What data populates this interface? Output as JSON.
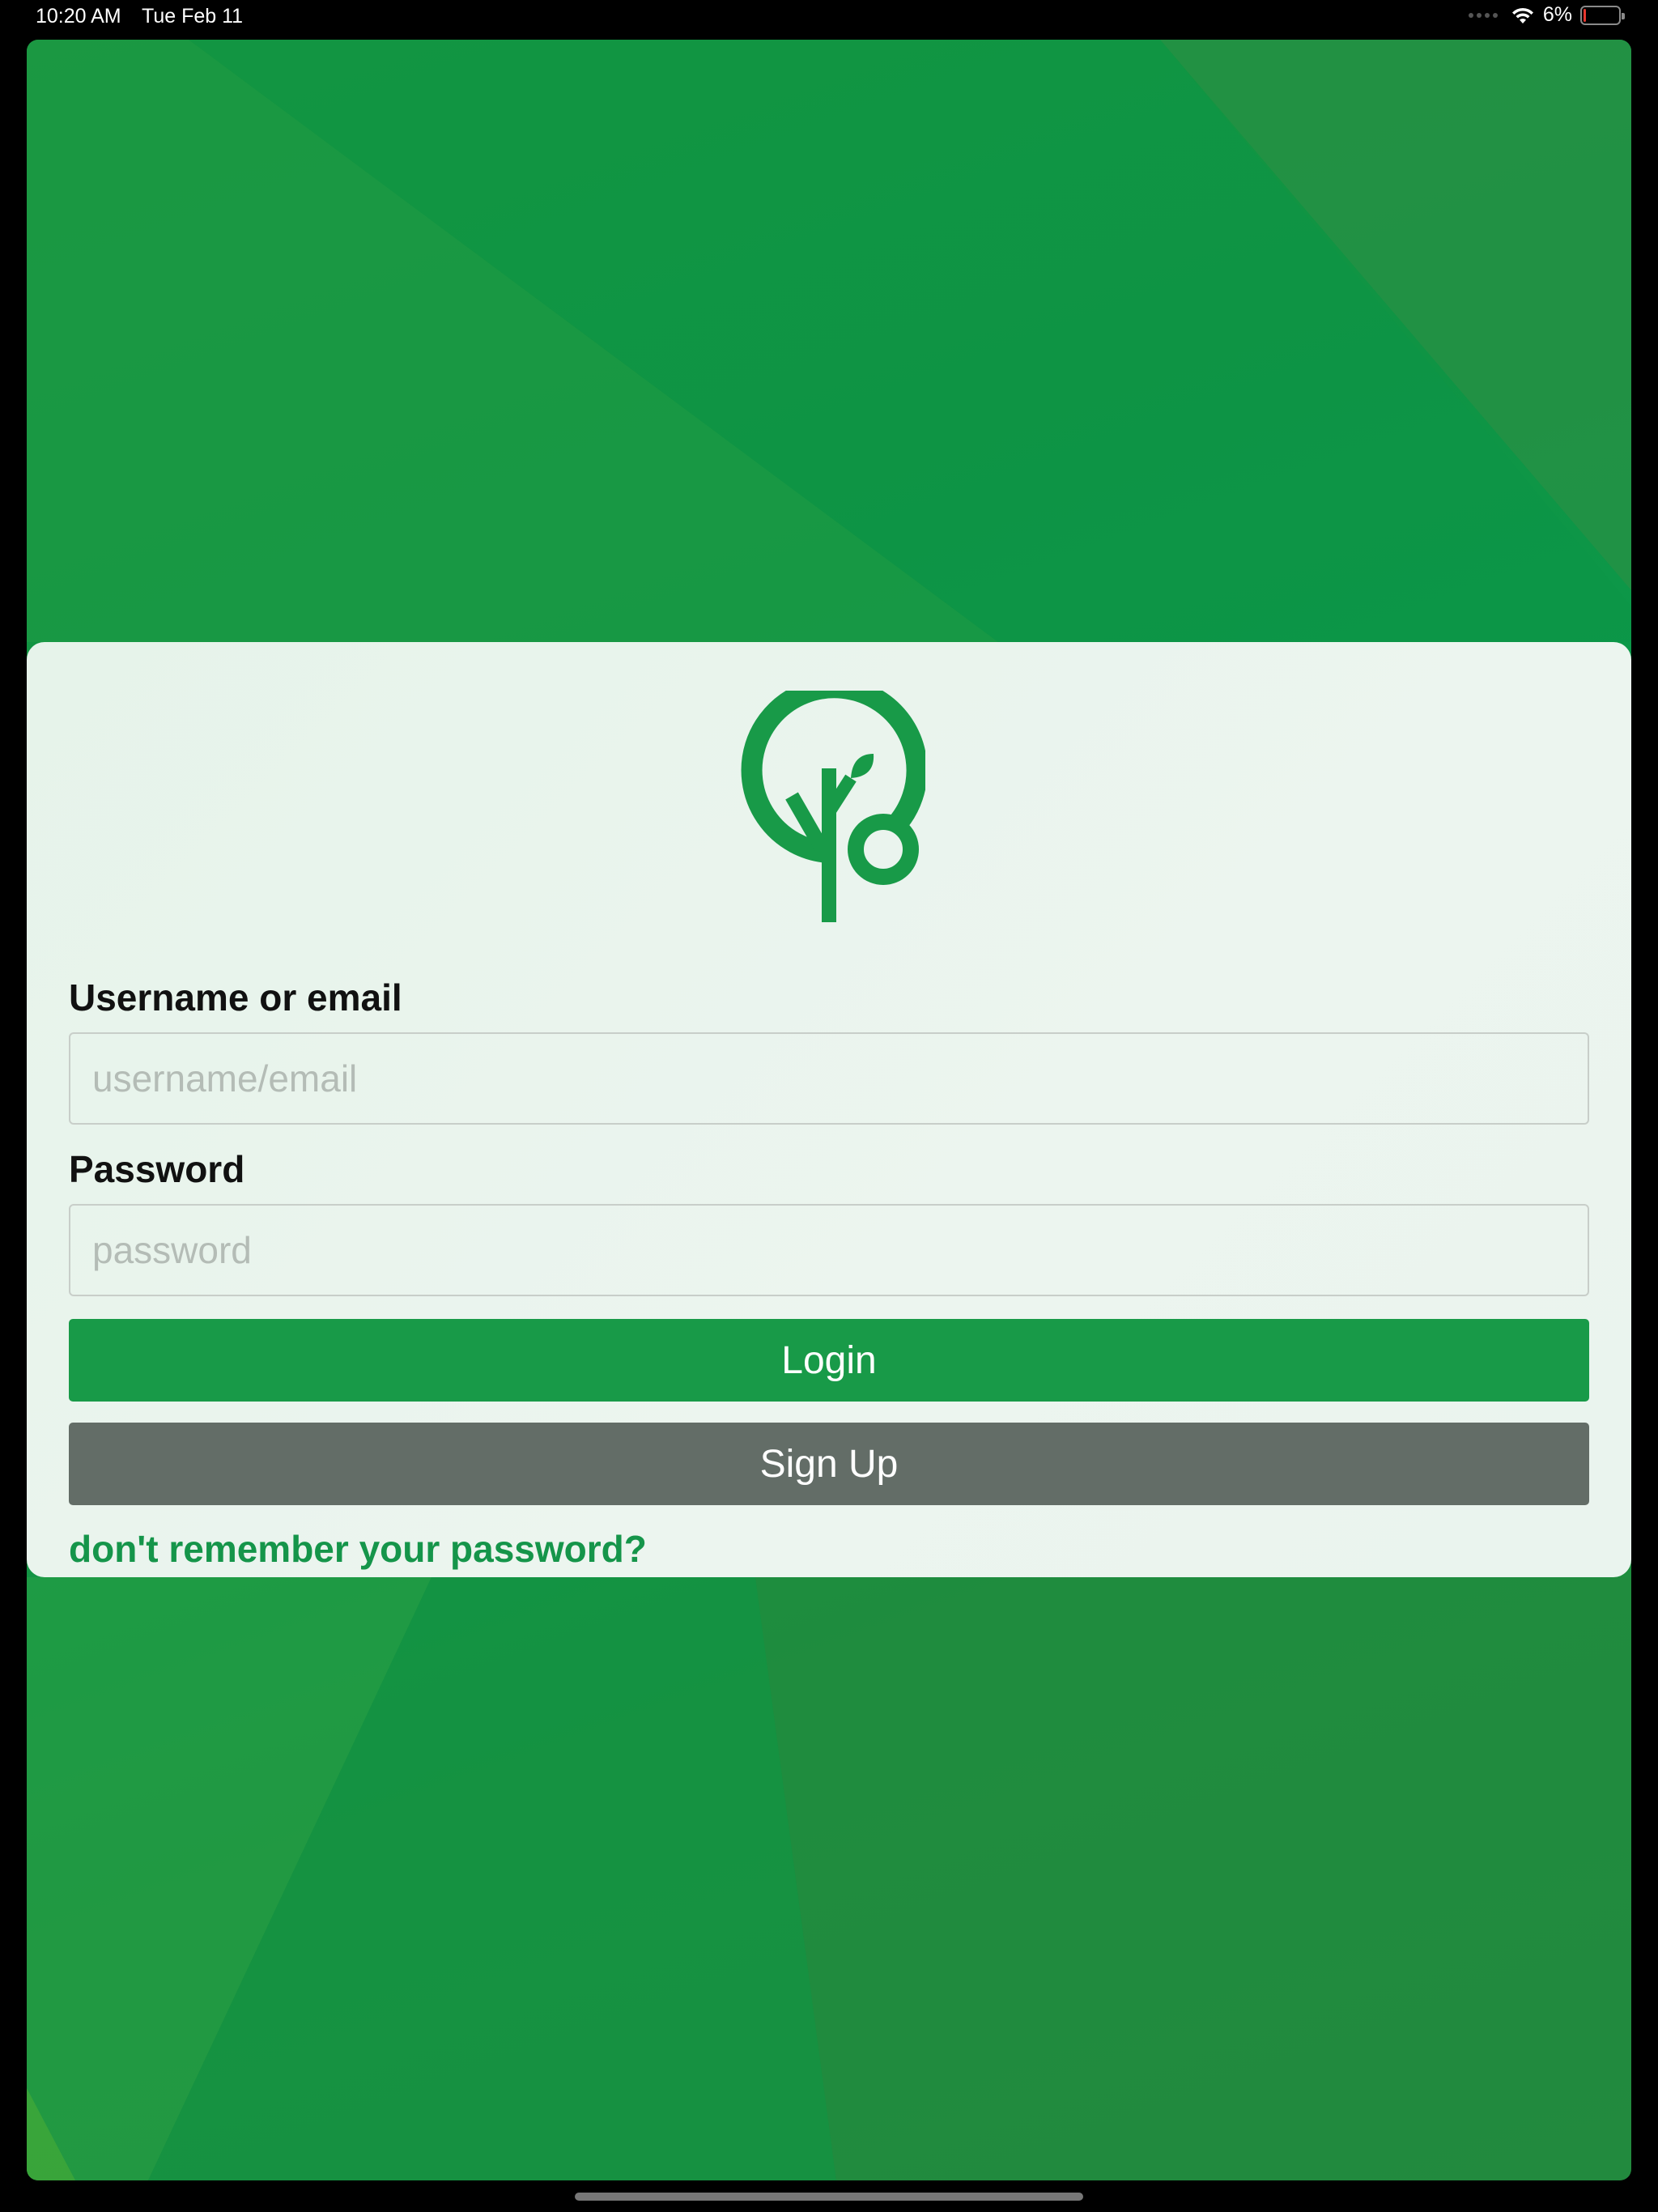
{
  "status_bar": {
    "time": "10:20 AM",
    "date": "Tue Feb 11",
    "battery_percent": "6%",
    "wifi_icon": "wifi-icon",
    "battery_level": 0.06
  },
  "colors": {
    "brand_green": "#189a48",
    "signup_gray": "#636d67",
    "link_green": "#15954a"
  },
  "login_form": {
    "logo_icon": "tree-logo-icon",
    "username_label": "Username or email",
    "username_placeholder": "username/email",
    "username_value": "",
    "password_label": "Password",
    "password_placeholder": "password",
    "password_value": "",
    "login_button": "Login",
    "signup_button": "Sign Up",
    "forgot_password_link": "don't remember your password?"
  }
}
